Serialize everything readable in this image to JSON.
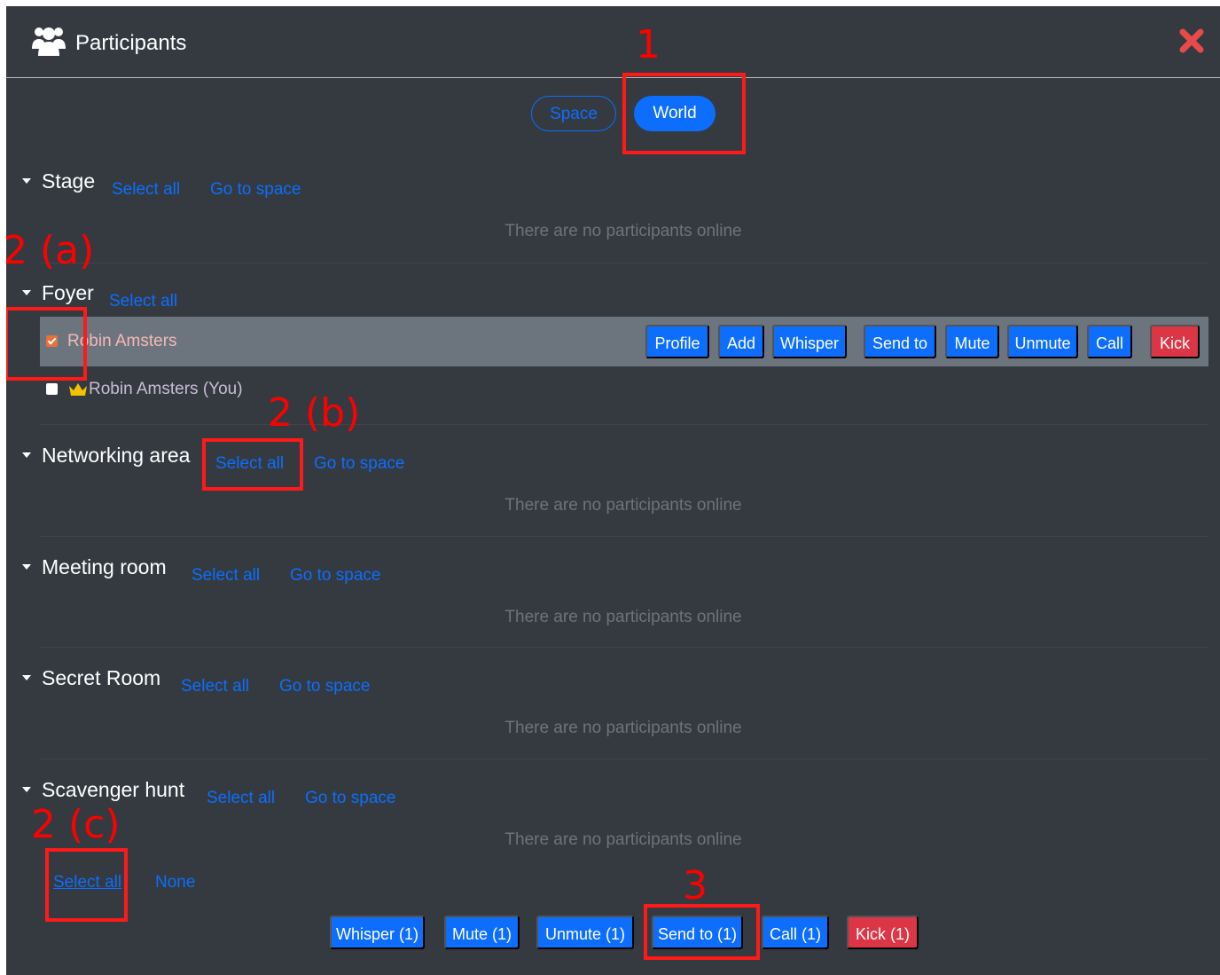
{
  "header": {
    "title": "Participants",
    "icon": "users-icon",
    "close_icon": "close-icon",
    "close_color": "#e84a4a"
  },
  "toggle": {
    "space": "Space",
    "world": "World",
    "active": "World"
  },
  "sections": [
    {
      "title": "Stage",
      "select_all": "Select all",
      "go_to_space": "Go to space",
      "empty": "There are no participants online"
    },
    {
      "title": "Foyer",
      "select_all": "Select all"
    },
    {
      "title": "Networking area",
      "select_all": "Select all",
      "go_to_space": "Go to space",
      "empty": "There are no participants online"
    },
    {
      "title": "Meeting room",
      "select_all": "Select all",
      "go_to_space": "Go to space",
      "empty": "There are no participants online"
    },
    {
      "title": "Secret Room",
      "select_all": "Select all",
      "go_to_space": "Go to space",
      "empty": "There are no participants online"
    },
    {
      "title": "Scavenger hunt",
      "select_all": "Select all",
      "go_to_space": "Go to space",
      "empty": "There are no participants online"
    }
  ],
  "participants": [
    {
      "name": "Robin Amsters",
      "checked": true,
      "actions": [
        "Profile",
        "Add",
        "Whisper",
        "Send to",
        "Mute",
        "Unmute",
        "Call",
        "Kick"
      ]
    },
    {
      "name": "Robin Amsters (You)",
      "checked": false,
      "icon": "crown-icon"
    }
  ],
  "footer": {
    "select_all": "Select all",
    "none": "None",
    "bulk_actions": [
      "Whisper (1)",
      "Mute (1)",
      "Unmute (1)",
      "Send to (1)",
      "Call (1)",
      "Kick (1)"
    ]
  },
  "annotations": {
    "step1": "1",
    "step2a": "2 (a)",
    "step2b": "2 (b)",
    "step2c": "2 (c)",
    "step3": "3"
  },
  "colors": {
    "panel": "#343a40",
    "accent": "#0d6efd",
    "danger": "#dc3545",
    "selected_row": "#6c757d",
    "annotation": "#ff0000"
  }
}
